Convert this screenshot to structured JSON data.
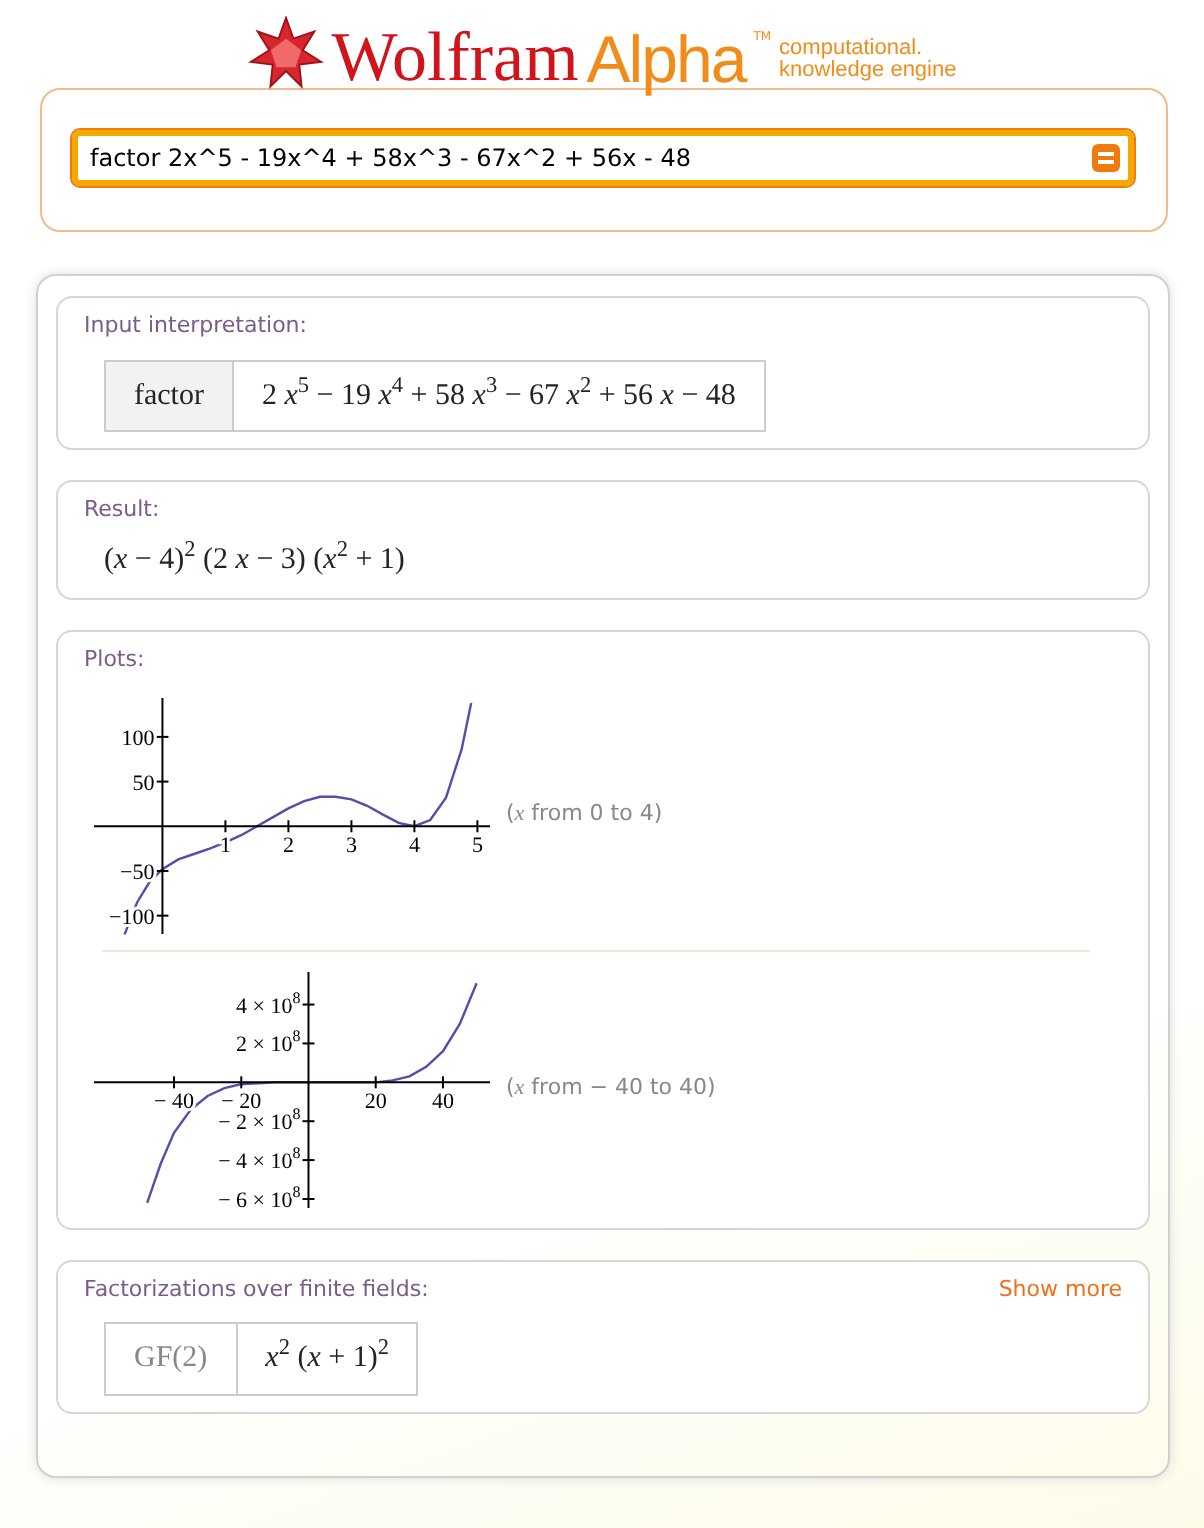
{
  "logo": {
    "brand_primary": "Wolfram",
    "brand_secondary": "Alpha",
    "trademark": "TM",
    "tagline": [
      "computational.",
      "knowledge engine"
    ]
  },
  "search": {
    "value": "factor 2x^5 - 19x^4 + 58x^3 - 67x^2 + 56x - 48"
  },
  "pods": [
    {
      "kind": "table",
      "title": "Input interpretation:",
      "cells": [
        {
          "kind": "label",
          "text": "factor"
        },
        {
          "kind": "math",
          "text": "2 *x*$^{5}$ − 19 *x*$^{4}$ + 58 *x*$^{3}$ − 67 *x*$^{2}$ + 56 *x* − 48"
        }
      ]
    },
    {
      "kind": "math",
      "title": "Result:",
      "text": "(*x* − 4)$^{2}$ (2 *x* − 3) (*x*$^{2}$ + 1)"
    },
    {
      "kind": "plots",
      "title": "Plots:",
      "plots": [
        {
          "range": "(*x* from 0 to 4)",
          "chart_data": {
            "type": "line",
            "xlim": [
              -1.15,
              5.2
            ],
            "ylim": [
              -125,
              148
            ],
            "xticks": [
              1,
              2,
              3,
              4,
              5
            ],
            "yticks": [
              {
                "value": -100,
                "label": "−100"
              },
              {
                "value": -50,
                "label": "−50"
              },
              {
                "value": 50,
                "label": "50"
              },
              {
                "value": 100,
                "label": "100"
              }
            ],
            "x": [
              -0.6,
              -0.4,
              -0.2,
              0,
              0.25,
              0.5,
              0.75,
              1,
              1.25,
              1.5,
              1.75,
              2,
              2.25,
              2.5,
              2.75,
              3,
              3.25,
              3.5,
              3.75,
              4,
              4.25,
              4.5,
              4.75,
              4.9
            ],
            "series": [
              {
                "color": "#5050a8",
                "values": [
                  -121,
                  -85,
                  -62,
                  -48,
                  -37,
                  -31,
                  -25,
                  -18,
                  -10,
                  0,
                  10,
                  20,
                  28,
                  33,
                  33,
                  30,
                  23,
                  13,
                  4,
                  0,
                  7,
                  32,
                  86,
                  138
                ]
              }
            ]
          }
        },
        {
          "range": "(*x* from − 40 to 40)",
          "chart_data": {
            "type": "line",
            "xlim": [
              -65,
              54
            ],
            "ylim": [
              -667000000,
              588000000
            ],
            "xticks": [
              {
                "value": -40,
                "label": "− 40"
              },
              {
                "value": -20,
                "label": "− 20"
              },
              {
                "value": 20,
                "label": "20"
              },
              {
                "value": 40,
                "label": "40"
              }
            ],
            "yticks": [
              {
                "value": -600000000,
                "label": "− 6 × 10$^{8}$"
              },
              {
                "value": -400000000,
                "label": "− 4 × 10$^{8}$"
              },
              {
                "value": -200000000,
                "label": "− 2 × 10$^{8}$"
              },
              {
                "value": 200000000,
                "label": "2 × 10$^{8}$"
              },
              {
                "value": 400000000,
                "label": "4 × 10$^{8}$"
              }
            ],
            "x": [
              -48,
              -44,
              -40,
              -35,
              -30,
              -25,
              -20,
              -10,
              0,
              10,
              20,
              25,
              30,
              35,
              40,
              45,
              50
            ],
            "series": [
              {
                "color": "#5050a8",
                "values": [
                  -620000000,
                  -420000000,
                  -260000000,
                  -140000000,
                  -70000000,
                  -30000000,
                  -10000000,
                  0,
                  0,
                  0,
                  0,
                  10000000,
                  30000000,
                  80000000,
                  160000000,
                  300000000,
                  510000000
                ]
              }
            ]
          }
        }
      ]
    },
    {
      "kind": "table",
      "title": "Factorizations over finite fields:",
      "action": "Show more",
      "cells": [
        {
          "kind": "label",
          "text": "GF(2)"
        },
        {
          "kind": "math",
          "text": "*x*$^{2}$ (*x* + 1)$^{2}$"
        }
      ]
    }
  ]
}
